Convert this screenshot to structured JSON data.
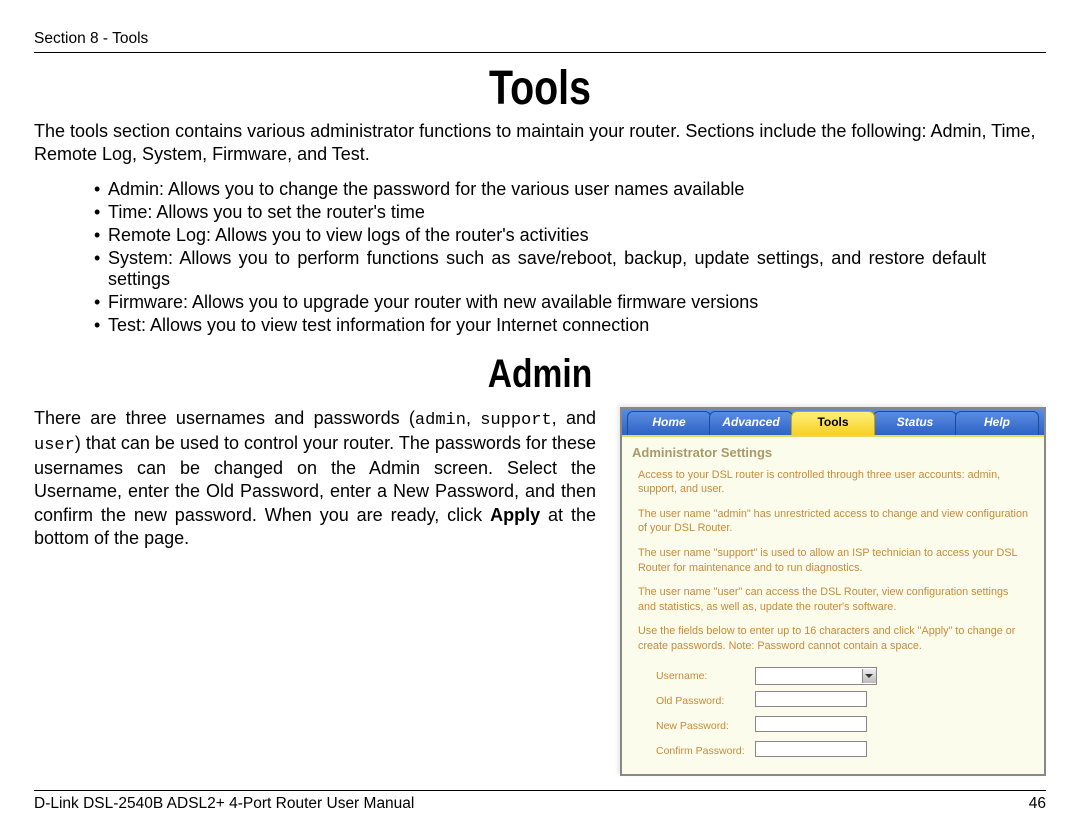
{
  "header": "Section 8 - Tools",
  "title1": "Tools",
  "intro": "The tools section contains various administrator functions to maintain your router. Sections include the following: Admin, Time, Remote Log, System, Firmware, and Test.",
  "bullets": [
    "Admin:  Allows you to change the password for the various user names available",
    "Time:  Allows you to set the router's time",
    "Remote Log:  Allows you to view logs of the router's activities",
    "System:  Allows you to perform functions such as save/reboot, backup, update settings, and restore default settings",
    "Firmware:  Allows you to upgrade your router with new available firmware versions",
    "Test:  Allows you to view test information for your Internet connection"
  ],
  "title2": "Admin",
  "admin_para_pre": "There are three usernames and passwords (",
  "u1": "admin",
  "sep1": ", ",
  "u2": "support",
  "sep2": ", and ",
  "u3": "user",
  "admin_para_mid": ") that can be used to control your router. The passwords for these usernames can be changed on the Admin screen.  Select the Username, enter the Old Password, enter a New Password, and then confirm the new password. When you are ready, click ",
  "apply": "Apply",
  "admin_para_end": " at the bottom of the page.",
  "tabs": {
    "home": "Home",
    "advanced": "Advanced",
    "tools": "Tools",
    "status": "Status",
    "help": "Help"
  },
  "panel": {
    "heading": "Administrator Settings",
    "p1": "Access to your DSL router is controlled through three user accounts: admin, support, and user.",
    "p2": "The user name \"admin\" has unrestricted access to change and view configuration of your DSL Router.",
    "p3": "The user name \"support\" is used to allow an ISP technician to access your DSL Router for maintenance and to run diagnostics.",
    "p4": "The user name \"user\" can access the DSL Router, view configuration settings and statistics, as well as, update the router's software.",
    "p5": "Use the fields below to enter up to 16 characters and click \"Apply\" to change or create passwords. Note: Password cannot contain a space.",
    "f_user": "Username:",
    "f_old": "Old Password:",
    "f_new": "New Password:",
    "f_conf": "Confirm Password:"
  },
  "footer_left": "D-Link DSL-2540B ADSL2+ 4-Port Router User Manual",
  "footer_right": "46"
}
